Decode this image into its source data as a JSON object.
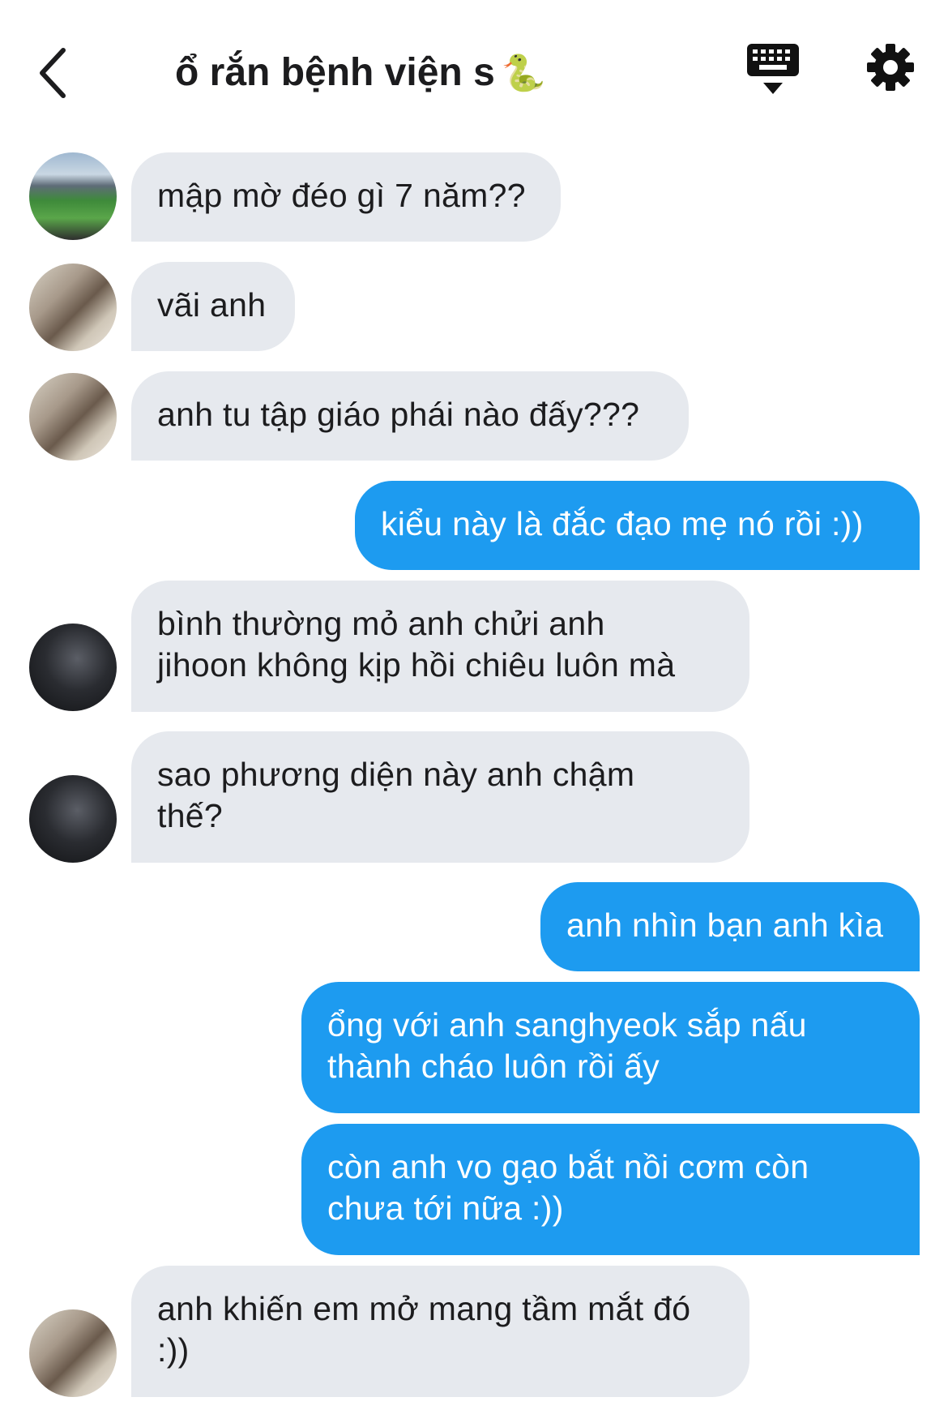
{
  "header": {
    "title": "ổ rắn bệnh viện s",
    "title_emoji": "🐍",
    "icons": {
      "back": "chevron-left-icon",
      "keyboard": "keyboard-icon",
      "settings": "gear-icon"
    }
  },
  "messages": [
    {
      "side": "in",
      "avatar": "stadium",
      "text": "mập mờ đéo gì 7 năm??"
    },
    {
      "side": "in",
      "avatar": "mirror",
      "text": "vãi anh"
    },
    {
      "side": "in",
      "avatar": "mirror",
      "text": "anh tu tập giáo phái nào đấy???"
    },
    {
      "side": "out",
      "text": "kiểu này là đắc đạo mẹ nó rồi :))"
    },
    {
      "side": "in",
      "avatar": "dark",
      "text": "bình thường mỏ anh chửi anh\njihoon không kịp hồi chiêu luôn mà"
    },
    {
      "side": "in",
      "avatar": "dark",
      "text": "sao phương diện này anh chậm\nthế?"
    },
    {
      "side": "out",
      "text": "anh nhìn bạn anh kìa"
    },
    {
      "side": "out",
      "text": "ổng với anh sanghyeok sắp nấu\nthành cháo luôn rồi ấy"
    },
    {
      "side": "out",
      "text": "còn anh vo gạo bắt nồi cơm còn\nchưa tới nữa :))"
    },
    {
      "side": "in",
      "avatar": "mirror",
      "text": "anh khiến em mở mang tầm mắt đó\n:))"
    }
  ],
  "colors": {
    "incoming_bubble": "#e6e9ee",
    "outgoing_bubble": "#1d9bf0",
    "background": "#ffffff"
  }
}
